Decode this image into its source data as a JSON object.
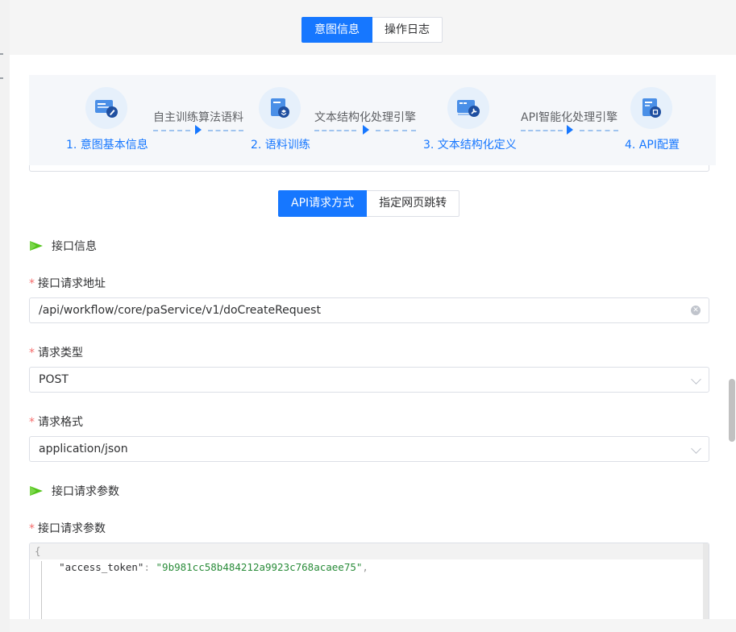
{
  "header_tabs": [
    {
      "label": "意图信息",
      "active": true
    },
    {
      "label": "操作日志",
      "active": false
    }
  ],
  "stepper": {
    "steps": [
      {
        "label": "1. 意图基本信息",
        "icon": "edit-form-icon"
      },
      {
        "label": "2. 语料训练",
        "icon": "layers-document-icon"
      },
      {
        "label": "3. 文本结构化定义",
        "icon": "wrench-window-icon"
      },
      {
        "label": "4. API配置",
        "icon": "api-document-icon"
      }
    ],
    "connectors": [
      {
        "label": "自主训练算法语料"
      },
      {
        "label": "文本结构化处理引擎"
      },
      {
        "label": "API智能化处理引擎"
      }
    ]
  },
  "sub_tabs": [
    {
      "label": "API请求方式",
      "active": true
    },
    {
      "label": "指定网页跳转",
      "active": false
    }
  ],
  "sections": {
    "interface_info": "接口信息",
    "request_params": "接口请求参数"
  },
  "fields": {
    "url": {
      "label": "接口请求地址",
      "value": "/api/workflow/core/paService/v1/doCreateRequest"
    },
    "method": {
      "label": "请求类型",
      "value": "POST"
    },
    "format": {
      "label": "请求格式",
      "value": "application/json"
    },
    "params": {
      "label": "接口请求参数"
    }
  },
  "code": {
    "line1": "{",
    "line2_key": "    \"access_token\"",
    "line2_colon": ": ",
    "line2_val": "\"9b981cc58b484212a9923c768acaee75\"",
    "line2_comma": ","
  },
  "colors": {
    "primary": "#1677ff",
    "required": "#f56c6c",
    "flag": "#52c41a"
  }
}
